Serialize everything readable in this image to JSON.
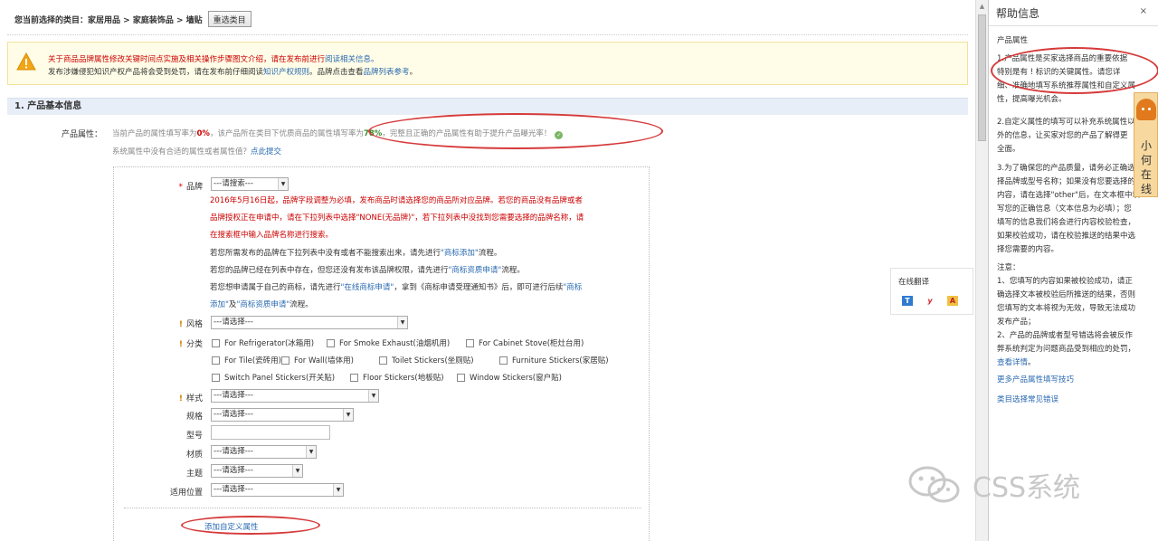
{
  "category_bar": {
    "prefix": "您当前选择的类目：",
    "path": "家居用品 > 家庭装饰品 > 墙贴",
    "reselect_button": "重选类目"
  },
  "notice": {
    "line1_text": "关于商品品牌属性修改关键时间点实施及相关操作步骤图文介绍，请在发布前进行",
    "line1_link": "阅读相关信息。",
    "line2_text1": "发布涉嫌侵犯知识产权产品将会受到处罚，请在发布前仔细阅读",
    "line2_link1": "知识产权规则",
    "line2_text2": "。品牌点击查看",
    "line2_link2": "品牌列表参考",
    "line2_end": "。"
  },
  "section": {
    "title": "1. 产品基本信息"
  },
  "product_attributes": {
    "label": "产品属性：",
    "summary_a": "当前产品的属性填写率为",
    "current_rate": "0%",
    "summary_b": "，该产品所在类目下优质商品的属性填写率为",
    "quality_rate": "78%",
    "summary_c": "，完整且正确的产品属性有助于提升产品曝光率！",
    "missing_text": "系统属性中没有合适的属性或者属性值？",
    "missing_link": "点此提交"
  },
  "brand": {
    "label": "品牌",
    "select_value": "---请搜索---",
    "notice_red": [
      "2016年5月16日起，品牌字段调整为必填，发布商品时请选择您的商品所对应品牌。若您的商品没有品牌或者",
      "品牌授权正在申请中，请在下拉列表中选择\"NONE(无品牌)\"，若下拉列表中没找到您需要选择的品牌名称，请",
      "在搜索框中输入品牌名称进行搜索。"
    ],
    "info1_text": "若您所需发布的品牌在下拉列表中没有或者不能搜索出来，请先进行",
    "info1_link": "\"商标添加\"",
    "info1_end": "流程。",
    "info2_text": "若您的品牌已经在列表中存在，但您还没有发布该品牌权限，请先进行",
    "info2_link": "\"商标资质申请\"",
    "info2_end": "流程。",
    "info3_text": "若您想申请属于自己的商标，请先进行",
    "info3_link1": "\"在线商标申请\"",
    "info3_mid": "，拿到《商标申请受理通知书》后，即可进行后续",
    "info3_link2": "\"商标",
    "info4_link1": "添加\"",
    "info4_mid": "及",
    "info4_link2": "\"商标资质申请\"",
    "info4_end": "流程。"
  },
  "fields": {
    "style": {
      "label": "风格",
      "value": "---请选择---"
    },
    "classification": {
      "label": "分类",
      "options": [
        "For Refrigerator(冰箱用)",
        "For Smoke Exhaust(油烟机用)",
        "For Cabinet Stove(柜灶台用)",
        "For Tile(瓷砖用)",
        "For Wall(墙体用)",
        "Toilet Stickers(坐厕贴)",
        "Furniture Stickers(家居贴)",
        "Switch Panel Stickers(开关贴)",
        "Floor Stickers(地板贴)",
        "Window Stickers(窗户贴)"
      ]
    },
    "pattern": {
      "label": "样式",
      "value": "---请选择---"
    },
    "spec": {
      "label": "规格",
      "value": "---请选择---"
    },
    "model": {
      "label": "型号",
      "value": ""
    },
    "material": {
      "label": "材质",
      "value": "---请选择---"
    },
    "theme": {
      "label": "主题",
      "value": "---请选择---"
    },
    "location": {
      "label": "适用位置",
      "value": "---请选择---"
    }
  },
  "add_custom_attribute": "添加自定义属性",
  "translate": {
    "title": "在线翻译"
  },
  "help_panel": {
    "title": "帮助信息",
    "close": "×",
    "subtitle": "产品属性",
    "para1": [
      "1.产品属性是买家选择商品的重要依据",
      "特别是有 ! 标识的关键属性。请您详",
      "细、准确地填写系统推荐属性和自定义属",
      "性，提高曝光机会。"
    ],
    "para2": [
      "2.自定义属性的填写可以补充系统属性以",
      "外的信息，让买家对您的产品了解得更",
      "全面。"
    ],
    "para3": [
      "3.为了确保您的产品质量，请务必正确选",
      "择品牌或型号名称；如果没有您要选择的",
      "内容，请在选择\"other\"后，在文本框中填",
      "写您的正确信息（文本信息为必填）；您",
      "填写的信息我们将会进行内容校验检查，",
      "如果校验成功，请在校验推送的结果中选",
      "择您需要的内容。"
    ],
    "note_title": "注意：",
    "note1": [
      "1、您填写的内容如果被校验成功，请正",
      "确选择文本被校验后所推送的结果，否则",
      "您填写的文本将视为无效，导致无法成功",
      "发布产品；"
    ],
    "note2": [
      "2、产品的品牌或者型号错选将会被反作",
      "弊系统判定为问题商品受到相应的处罚，"
    ],
    "note2_link": "查看详情",
    "note2_end": "。",
    "link1": "更多产品属性填写技巧",
    "link2": "类目选择常见错误"
  },
  "service_widget": {
    "label": "小何在线"
  },
  "watermark": {
    "text": "CSS系统"
  },
  "colors": {
    "accent_red": "#c00000",
    "link_blue": "#2a6ab0",
    "notice_bg": "#fffde7",
    "section_bg": "#e8eef7",
    "annotation_circle": "#d63a3a"
  }
}
